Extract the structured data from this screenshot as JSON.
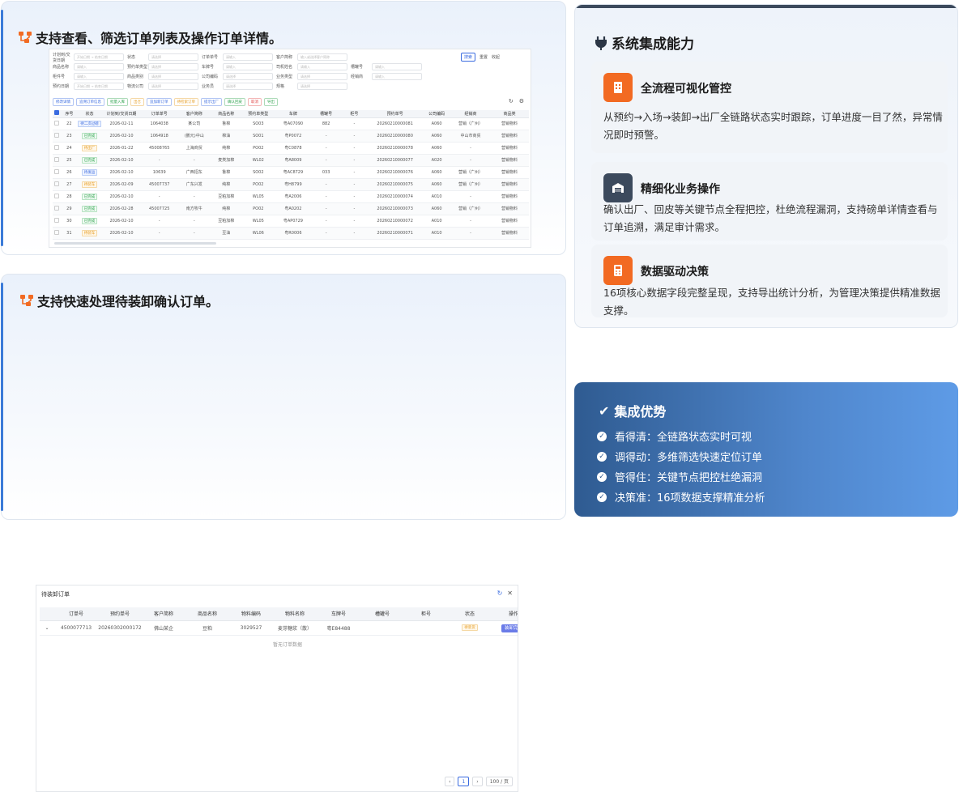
{
  "card1": {
    "title": "支持查看、筛选订单列表及操作订单详情。",
    "filters": [
      [
        {
          "label": "计划到/交货日期",
          "ph": "开始日期 → 结束日期"
        },
        {
          "label": "状态",
          "ph": "请选择"
        },
        {
          "label": "订单单号",
          "ph": "请输入"
        },
        {
          "label": "客户简称",
          "ph": "输入或选择客户简称"
        }
      ],
      [
        {
          "label": "商品名称",
          "ph": "请输入"
        },
        {
          "label": "预约单类型",
          "ph": "请选择"
        },
        {
          "label": "车牌号",
          "ph": "请输入"
        },
        {
          "label": "司机姓名",
          "ph": "请输入"
        },
        {
          "label": "槽罐号",
          "ph": "请输入"
        }
      ],
      [
        {
          "label": "柜件号",
          "ph": "请输入"
        },
        {
          "label": "商品类别",
          "ph": "请选择"
        },
        {
          "label": "公司编码",
          "ph": "请选择"
        },
        {
          "label": "业务类型",
          "ph": "请选择"
        },
        {
          "label": "经销商",
          "ph": "请输入"
        }
      ],
      [
        {
          "label": "预约日期",
          "ph": "开始日期 → 结束日期"
        },
        {
          "label": "物流公司",
          "ph": "请选择"
        },
        {
          "label": "业务员",
          "ph": "请选择"
        },
        {
          "label": "规格",
          "ph": "请选择"
        }
      ]
    ],
    "search_btn": "搜索",
    "reset_btn": "重置",
    "collapse_btn": "收起",
    "toolbar": [
      "修改详情",
      "追溯订单信息",
      "批量入库",
      "出仓",
      "追加新订单",
      "待检索订单",
      "提示出厂",
      "确认回皮",
      "取消",
      "导出"
    ],
    "headers": [
      "",
      "序号",
      "状态",
      "计划到/交货日期",
      "订单单号",
      "客户简称",
      "商品名称",
      "预约单类型",
      "车牌",
      "槽罐号",
      "柜号",
      "预约单号",
      "公司编码",
      "经销商",
      "商品类"
    ],
    "rows": [
      [
        "22",
        "待二次过磅",
        "2026-02-11",
        "1064038",
        "某公司",
        "鲁棉",
        "SO03",
        "粤A07090",
        "882",
        "-",
        "20260210000081",
        "A060",
        "营销（广州）",
        "营销物料"
      ],
      [
        "23",
        "已完成",
        "2026-02-10",
        "1064918",
        "(鹏元)中山",
        "棉油",
        "SO01",
        "粤P0072",
        "-",
        "-",
        "20260210000080",
        "A060",
        "中山市商贸",
        "营销物料"
      ],
      [
        "24",
        "待出厂",
        "2026-01-22",
        "45008765",
        "上海商贸",
        "纯棉",
        "PO02",
        "粤C0878",
        "-",
        "-",
        "20260210000078",
        "A060",
        "-",
        "营销物料"
      ],
      [
        "25",
        "已完成",
        "2026-02-10",
        "-",
        "-",
        "麦类加棉",
        "WL02",
        "粤A8009",
        "-",
        "-",
        "20260210000077",
        "A020",
        "-",
        "营销物料"
      ],
      [
        "26",
        "待发运",
        "2026-02-10",
        "10639",
        "广西招东",
        "鲁棉",
        "SO02",
        "粤AC8729",
        "033",
        "-",
        "20260210000076",
        "A060",
        "营销（广州）",
        "营销物料"
      ],
      [
        "27",
        "待装车",
        "2026-02-09",
        "45007737",
        "广东兴发",
        "纯棉",
        "PO02",
        "粤H8799",
        "-",
        "-",
        "20260210000075",
        "A060",
        "营销（广州）",
        "营销物料"
      ],
      [
        "28",
        "已完成",
        "2026-02-10",
        "-",
        "-",
        "豆粕加棉",
        "WL05",
        "粤A2006",
        "-",
        "-",
        "20260210000074",
        "A010",
        "-",
        "营销物料"
      ],
      [
        "29",
        "已完成",
        "2026-02-28",
        "45007725",
        "南方牧牛",
        "纯棉",
        "PO02",
        "粤A0202",
        "-",
        "-",
        "20260210000073",
        "A060",
        "营销（广州）",
        "营销物料"
      ],
      [
        "30",
        "已完成",
        "2026-02-10",
        "-",
        "-",
        "豆粕加棉",
        "WL05",
        "粤AP0729",
        "-",
        "-",
        "20260210000072",
        "A010",
        "-",
        "营销物料"
      ],
      [
        "31",
        "待装车",
        "2026-02-10",
        "-",
        "-",
        "豆油",
        "WL06",
        "粤R0006",
        "-",
        "-",
        "20260210000071",
        "A010",
        "-",
        "营销物料"
      ]
    ]
  },
  "card2": {
    "title": "支持快速处理待装卸确认订单。",
    "panel_title": "待装卸订单",
    "headers": [
      "",
      "订单号",
      "预约单号",
      "客户简称",
      "商品名称",
      "物料编码",
      "物料名称",
      "车牌号",
      "槽罐号",
      "柜号",
      "状态",
      "操作"
    ],
    "row": [
      "4500077713",
      "20260302000172",
      "佛山某企",
      "豆粕",
      "3029527",
      "麦芽糖浆（散）",
      "粤E84488",
      "",
      "",
      "待装货",
      "装卸完成"
    ],
    "empty": "暂无订单数据",
    "page": "1",
    "page_size": "100 / 页"
  },
  "right": {
    "title": "系统集成能力",
    "items": [
      {
        "title": "全流程可视化管控",
        "desc": "从预约→入场→装卸→出厂全链路状态实时跟踪，订单进度一目了然，异常情况即时预警。"
      },
      {
        "title": "精细化业务操作",
        "desc": "确认出厂、回皮等关键节点全程把控，杜绝流程漏洞，支持磅单详情查看与订单追溯，满足审计需求。"
      },
      {
        "title": "数据驱动决策",
        "desc": "16项核心数据字段完整呈现，支持导出统计分析，为管理决策提供精准数据支撑。"
      }
    ]
  },
  "advantage": {
    "title": "集成优势",
    "items": [
      "看得清：全链路状态实时可视",
      "调得动：多维筛选快速定位订单",
      "管得住：关键节点把控杜绝漏洞",
      "决策准：16项数据支撑精准分析"
    ]
  },
  "colors": {
    "accent": "#f26a22",
    "primary": "#3a6be0",
    "dark": "#3c4a5d"
  }
}
